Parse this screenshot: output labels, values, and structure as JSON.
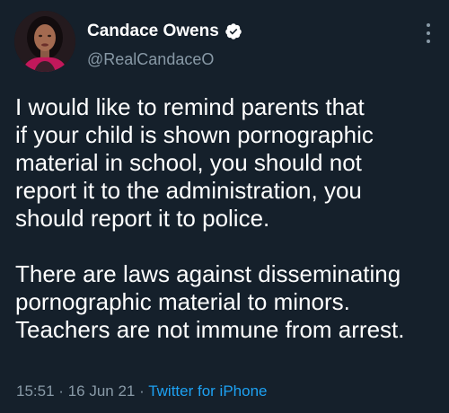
{
  "author": {
    "display_name": "Candace Owens",
    "handle": "@RealCandaceO",
    "verified": true,
    "avatar_icon": "profile-photo-icon"
  },
  "tweet": {
    "paragraphs": [
      {
        "lines": [
          "I would like to remind parents that",
          "if your child is shown pornographic",
          "material in school, you should not",
          "report it to the administration, you",
          "should report it to police."
        ]
      },
      {
        "lines": [
          "There are laws against disseminating",
          "pornographic material to minors.",
          "Teachers are not immune from arrest."
        ]
      }
    ],
    "time": "15:51",
    "separator": "·",
    "date": "16 Jun 21",
    "source": "Twitter for iPhone"
  },
  "colors": {
    "background": "#15202b",
    "text": "#ffffff",
    "secondary": "#8899a6",
    "link": "#1da1f2"
  }
}
